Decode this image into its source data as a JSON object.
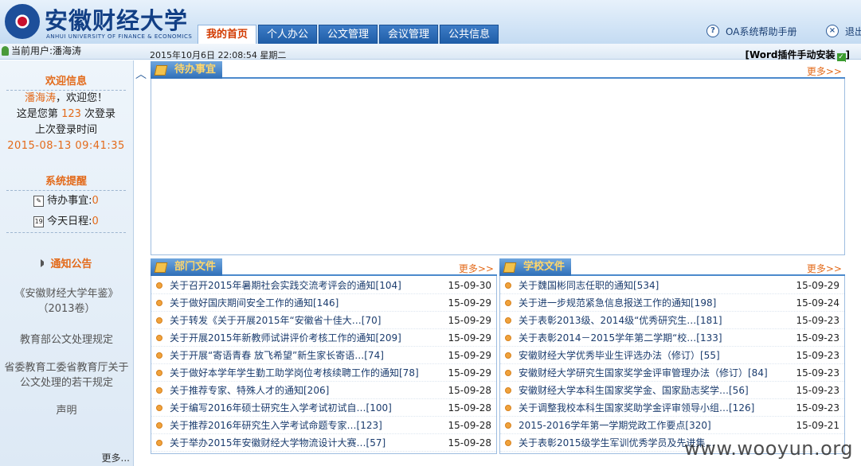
{
  "header": {
    "school_name": "安徽财经大学",
    "school_name_en": "ANHUI UNIVERSITY OF FINANCE & ECONOMICS",
    "nav_tabs": [
      {
        "label": "我的首页",
        "active": true
      },
      {
        "label": "个人办公",
        "active": false
      },
      {
        "label": "公文管理",
        "active": false
      },
      {
        "label": "会议管理",
        "active": false
      },
      {
        "label": "公共信息",
        "active": false
      }
    ],
    "help_label": "OA系统帮助手册",
    "logout_label": "退出"
  },
  "infobar": {
    "current_user": "当前用户:潘海涛",
    "datetime": "2015年10月6日 22:08:54 星期二",
    "plugin_link": "[Word插件手动安装",
    "plugin_link_end": "]"
  },
  "sidebar": {
    "welcome_title": "欢迎信息",
    "user_name": "潘海涛",
    "greeting_suffix": "，欢迎您！",
    "login_prefix": "这是您第",
    "login_count": "123",
    "login_suffix": "次登录",
    "last_login_label": "上次登录时间",
    "last_login_time": "2015-08-13 09:41:35",
    "reminder_title": "系统提醒",
    "todo_label": "待办事宜:",
    "todo_count": "0",
    "schedule_label": "今天日程:",
    "schedule_count": "0",
    "notice_title": "通知公告",
    "notices": [
      "《安徽财经大学年鉴》（2013卷）",
      "教育部公文处理规定",
      "省委教育工委省教育厅关于公文处理的若干规定",
      "声明"
    ],
    "more_label": "更多..."
  },
  "todo_panel": {
    "title": "待办事宜",
    "more": "更多>>"
  },
  "dept_panel": {
    "title": "部门文件",
    "more": "更多>>",
    "items": [
      {
        "title": "关于召开2015年暑期社会实践交流考评会的通知[104]",
        "date": "15-09-30"
      },
      {
        "title": "关于做好国庆期间安全工作的通知[146]",
        "date": "15-09-29"
      },
      {
        "title": "关于转发《关于开展2015年“安徽省十佳大…[70]",
        "date": "15-09-29"
      },
      {
        "title": "关于开展2015年新教师试讲评价考核工作的通知[209]",
        "date": "15-09-29"
      },
      {
        "title": "关于开展“寄语青春 放飞希望”新生家长寄语…[74]",
        "date": "15-09-29"
      },
      {
        "title": "关于做好本学年学生勤工助学岗位考核续聘工作的通知[78]",
        "date": "15-09-29"
      },
      {
        "title": "关于推荐专家、特殊人才的通知[206]",
        "date": "15-09-28"
      },
      {
        "title": "关于编写2016年硕士研究生入学考试初试自…[100]",
        "date": "15-09-28"
      },
      {
        "title": "关于推荐2016年研究生入学考试命题专家…[123]",
        "date": "15-09-28"
      },
      {
        "title": "关于举办2015年安徽财经大学物流设计大赛…[57]",
        "date": "15-09-28"
      }
    ]
  },
  "school_panel": {
    "title": "学校文件",
    "more": "更多>>",
    "items": [
      {
        "title": "关于魏国彬同志任职的通知[534]",
        "date": "15-09-29"
      },
      {
        "title": "关于进一步规范紧急信息报送工作的通知[198]",
        "date": "15-09-24"
      },
      {
        "title": "关于表彰2013级、2014级“优秀研究生…[181]",
        "date": "15-09-23"
      },
      {
        "title": "关于表彰2014－2015学年第二学期“校…[133]",
        "date": "15-09-23"
      },
      {
        "title": "安徽财经大学优秀毕业生评选办法（修订）[55]",
        "date": "15-09-23"
      },
      {
        "title": "安徽财经大学研究生国家奖学金评审管理办法（修订）[84]",
        "date": "15-09-23"
      },
      {
        "title": "安徽财经大学本科生国家奖学金、国家励志奖学…[56]",
        "date": "15-09-23"
      },
      {
        "title": "关于调整我校本科生国家奖助学金评审领导小组…[126]",
        "date": "15-09-23"
      },
      {
        "title": "2015-2016学年第一学期党政工作要点[320]",
        "date": "15-09-21"
      },
      {
        "title": "关于表彰2015级学生军训优秀学员及先进集…",
        "date": ""
      }
    ]
  },
  "watermark": "www.wooyun.org"
}
